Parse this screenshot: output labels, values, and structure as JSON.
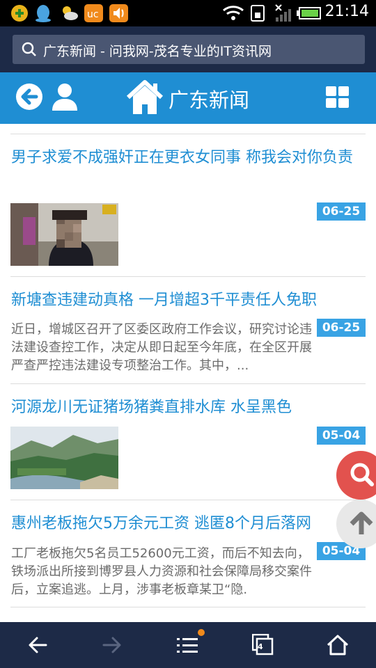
{
  "status_bar": {
    "time": "21:14",
    "icons": [
      "app-icon",
      "qq-icon",
      "weather-icon",
      "uc-browser-icon",
      "sound-icon",
      "wifi-icon",
      "sim-icon",
      "signal-icon",
      "battery-icon"
    ]
  },
  "browser": {
    "address_text": "广东新闻 - 问我网-茂名专业的IT资讯网"
  },
  "header": {
    "title": "广东新闻"
  },
  "articles": [
    {
      "title": "男子求爱不成强奸正在更衣女同事 称我会对你负责",
      "date": "06-25",
      "summary": "",
      "thumb": "person"
    },
    {
      "title": "新塘查违建动真格 一月增超3千平责任人免职",
      "date": "06-25",
      "summary": "近日，增城区召开了区委区政府工作会议，研究讨论违法建设查控工作，决定从即日起至今年底，在全区开展严查严控违法建设专项整治工作。其中，...",
      "thumb": ""
    },
    {
      "title": "河源龙川无证猪场猪粪直排水库 水呈黑色",
      "date": "05-04",
      "summary": "",
      "thumb": "landscape"
    },
    {
      "title": "惠州老板拖欠5万余元工资 逃匿8个月后落网",
      "date": "05-04",
      "summary": "工厂老板拖欠5名员工52600元工资，而后不知去向，铁场派出所接到博罗县人力资源和社会保障局移交案件后，立案追逃。上月，涉事老板章某卫“隐.",
      "thumb": ""
    }
  ],
  "bottom_nav": {
    "tab_count": "4"
  },
  "colors": {
    "brand": "#1f8ed3",
    "badge": "#39a3e4",
    "browser_chrome": "#1d2a47",
    "float_search": "#e2524e"
  }
}
